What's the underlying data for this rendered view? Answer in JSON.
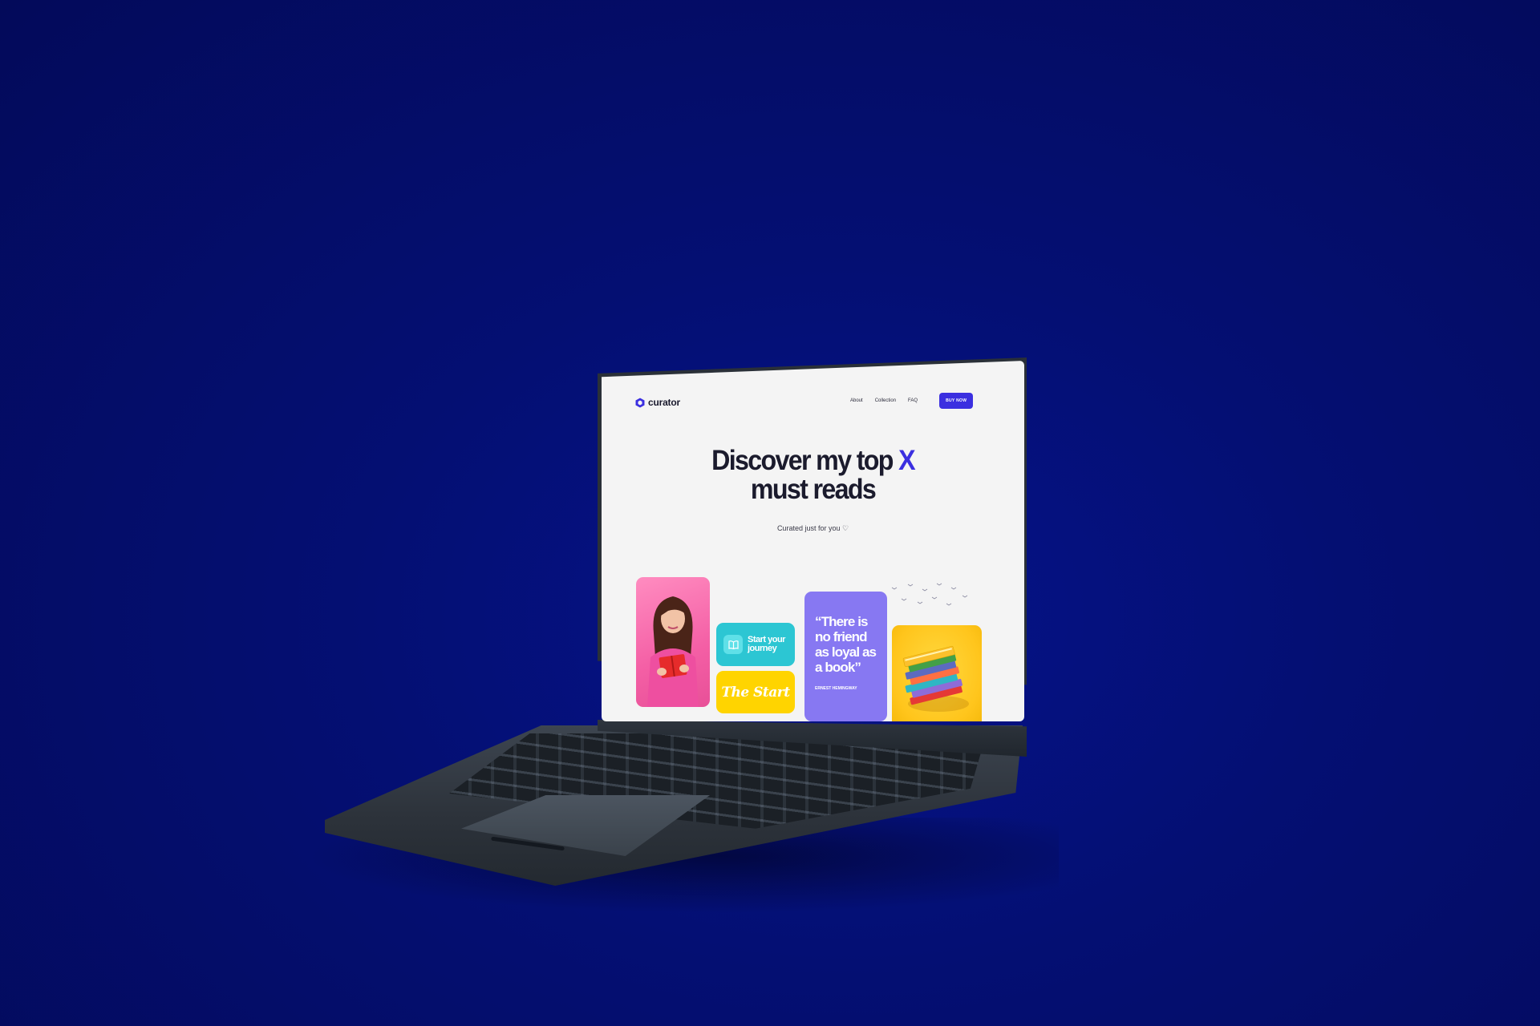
{
  "site": {
    "logo_text": "curator",
    "nav": {
      "links": [
        "About",
        "Collection",
        "FAQ"
      ],
      "cta_label": "BUY NOW"
    }
  },
  "hero": {
    "title_line1": "Discover my top ",
    "title_accent": "X",
    "title_line2": "must reads",
    "subtitle": "Curated just for you ♡"
  },
  "cards": {
    "journey_label": "Start your journey",
    "start_label": "The Start",
    "quote": "“There is no friend as loyal as a book”",
    "quote_author": "ERNEST HEMINGWAY"
  },
  "colors": {
    "background": "#040f73",
    "accent": "#3b2fe0",
    "pink": "#f45fa5",
    "cyan": "#2cc6d3",
    "yellow": "#ffd400",
    "purple": "#8778f2"
  }
}
